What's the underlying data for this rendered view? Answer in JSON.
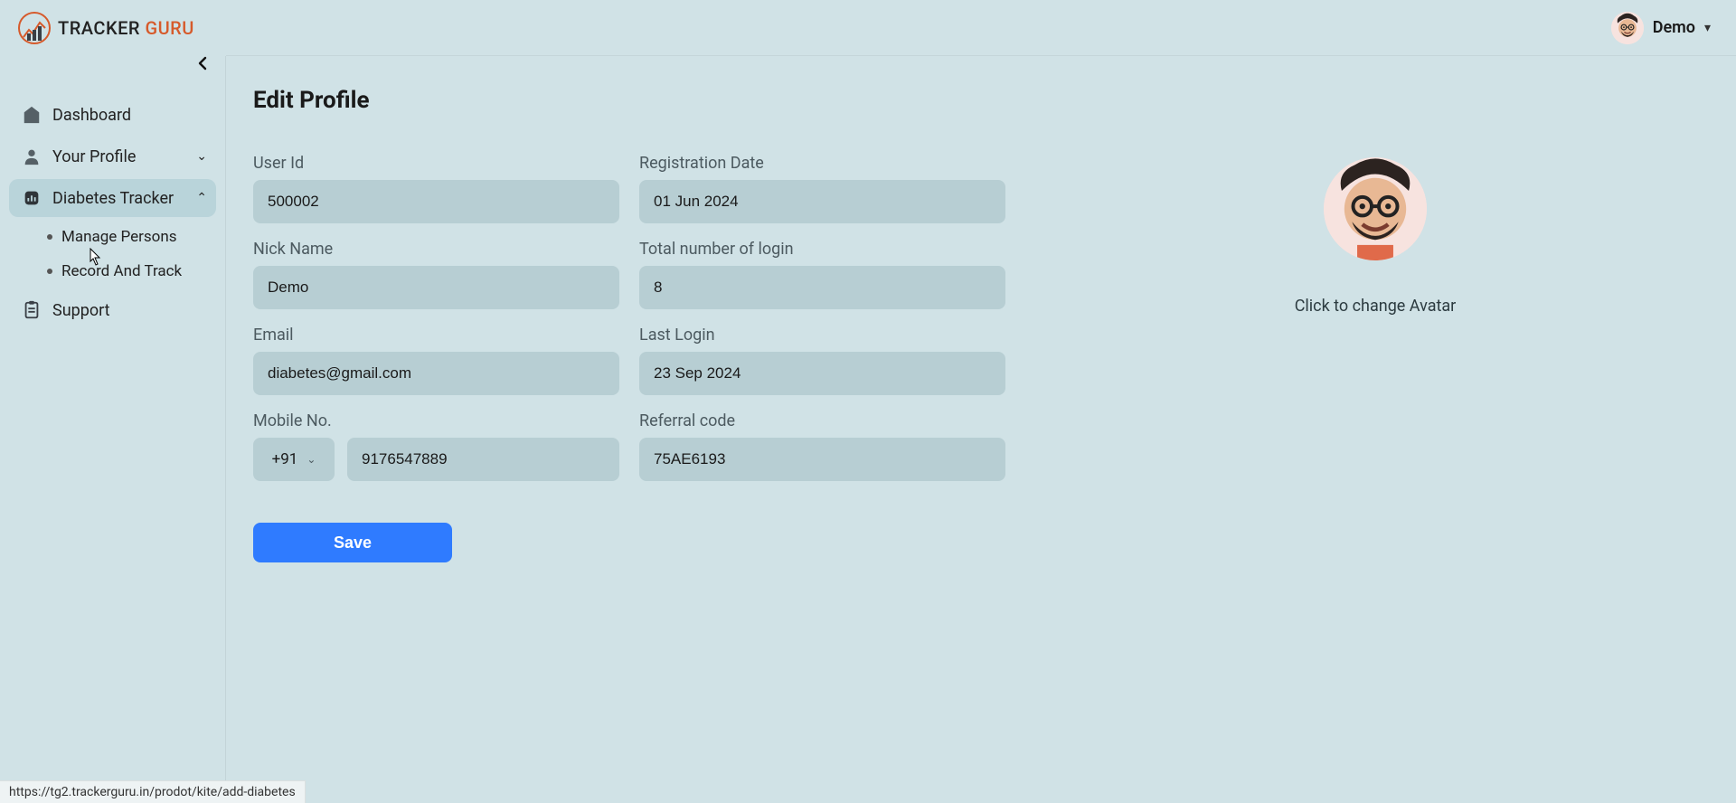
{
  "brand": {
    "name1": "TRACKER ",
    "name2": "GURU"
  },
  "header": {
    "username": "Demo"
  },
  "sidebar": {
    "items": [
      {
        "label": "Dashboard"
      },
      {
        "label": "Your Profile"
      },
      {
        "label": "Diabetes Tracker"
      },
      {
        "label": "Support"
      }
    ],
    "diabetes_sub": [
      {
        "label": "Manage Persons"
      },
      {
        "label": "Record And Track"
      }
    ]
  },
  "page": {
    "title": "Edit Profile"
  },
  "form": {
    "user_id": {
      "label": "User Id",
      "value": "500002"
    },
    "reg_date": {
      "label": "Registration Date",
      "value": "01 Jun 2024"
    },
    "nick": {
      "label": "Nick Name",
      "value": "Demo"
    },
    "login_count": {
      "label": "Total number of login",
      "value": "8"
    },
    "email": {
      "label": "Email",
      "value": "diabetes@gmail.com"
    },
    "last_login": {
      "label": "Last Login",
      "value": "23 Sep 2024"
    },
    "mobile": {
      "label": "Mobile No.",
      "cc": "+91",
      "value": "9176547889"
    },
    "referral": {
      "label": "Referral code",
      "value": "75AE6193"
    },
    "save_label": "Save"
  },
  "avatar": {
    "caption": "Click to change Avatar"
  },
  "status_url": "https://tg2.trackerguru.in/prodot/kite/add-diabetes"
}
